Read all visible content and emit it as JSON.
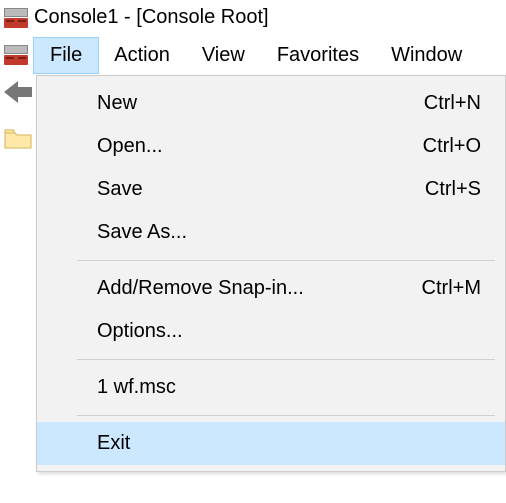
{
  "titlebar": {
    "title": "Console1 - [Console Root]"
  },
  "menubar": {
    "file": "File",
    "action": "Action",
    "view": "View",
    "favorites": "Favorites",
    "window": "Window"
  },
  "file_menu": {
    "new": {
      "label": "New",
      "shortcut": "Ctrl+N"
    },
    "open": {
      "label": "Open...",
      "shortcut": "Ctrl+O"
    },
    "save": {
      "label": "Save",
      "shortcut": "Ctrl+S"
    },
    "save_as": {
      "label": "Save As..."
    },
    "add_remove": {
      "label": "Add/Remove Snap-in...",
      "shortcut": "Ctrl+M"
    },
    "options": {
      "label": "Options..."
    },
    "recent1": {
      "label": "1 wf.msc"
    },
    "exit": {
      "label": "Exit"
    }
  }
}
